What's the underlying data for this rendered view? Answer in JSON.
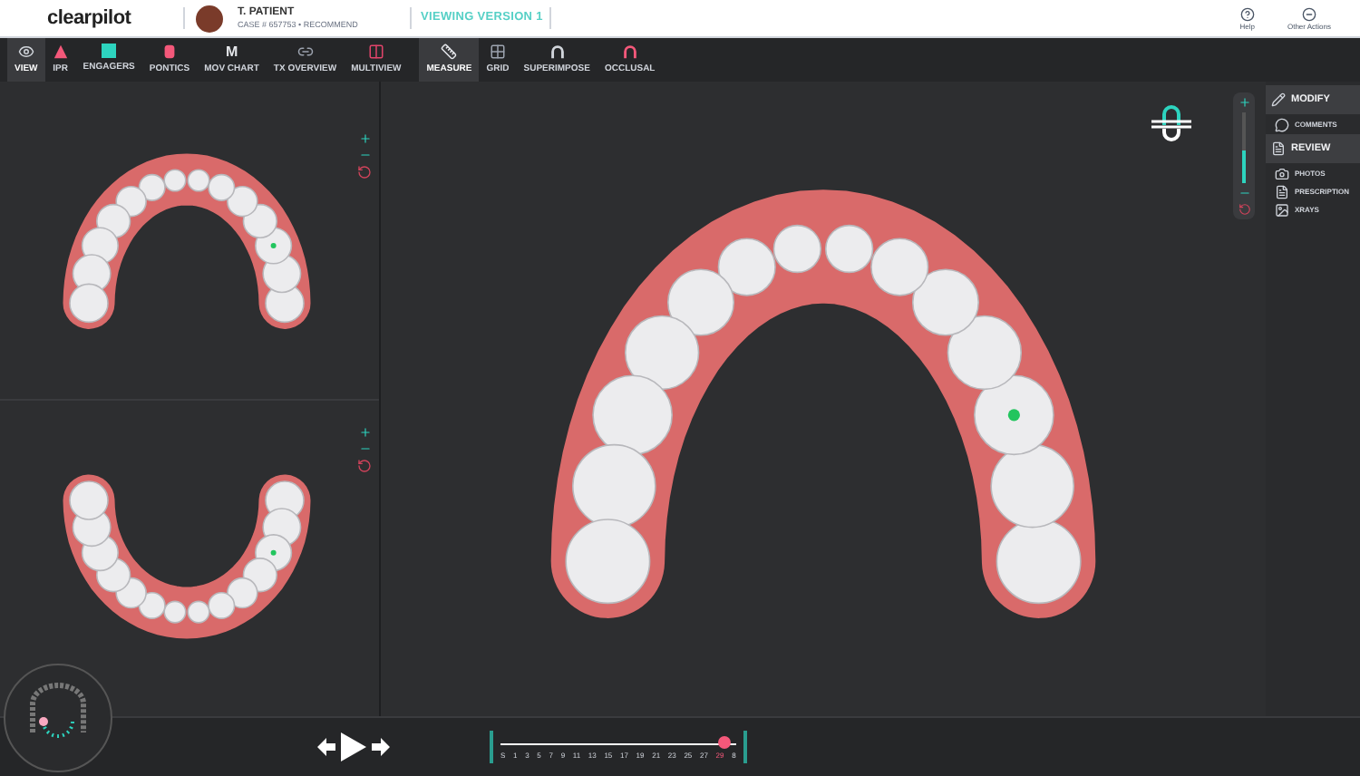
{
  "header": {
    "logo": "clearpilot",
    "patient_name": "T. PATIENT",
    "case_info": "CASE # 657753 • RECOMMEND",
    "version": "VIEWING VERSION 1",
    "actions": [
      {
        "label": "Help",
        "kind": "help"
      },
      {
        "label": "Other Actions",
        "kind": "more"
      }
    ]
  },
  "toolbar": [
    {
      "label": "VIEW",
      "kind": "eye",
      "selected": true
    },
    {
      "label": "IPR",
      "kind": "triangle",
      "selected": false
    },
    {
      "label": "ENGAGERS",
      "kind": "square",
      "selected": false
    },
    {
      "label": "PONTICS",
      "kind": "pontic",
      "selected": false
    },
    {
      "label": "MOV CHART",
      "kind": "letter",
      "icon_text": "M",
      "selected": false
    },
    {
      "label": "TX OVERVIEW",
      "kind": "link",
      "selected": false
    },
    {
      "label": "MULTIVIEW",
      "kind": "multiview",
      "selected": false
    },
    {
      "label": "MEASURE",
      "kind": "measure",
      "selected": true
    },
    {
      "label": "GRID",
      "kind": "grid",
      "selected": false
    },
    {
      "label": "SUPERIMPOSE",
      "kind": "arch",
      "selected": false
    },
    {
      "label": "OCCLUSAL",
      "kind": "arch-red",
      "selected": false
    }
  ],
  "zoom_slider": {
    "level": 0.45
  },
  "side_panel": [
    {
      "label": "MODIFY",
      "kind": "section"
    },
    {
      "label": "COMMENTS",
      "kind": "item"
    },
    {
      "label": "REVIEW",
      "kind": "section"
    },
    {
      "label": "PHOTOS",
      "kind": "item"
    },
    {
      "label": "PRESCRIPTION",
      "kind": "item"
    },
    {
      "label": "XRAYS",
      "kind": "item"
    }
  ],
  "timeline": {
    "level": 0.95,
    "labels": [
      {
        "text": "S",
        "selected": false
      },
      {
        "text": "1",
        "selected": false
      },
      {
        "text": "3",
        "selected": false
      },
      {
        "text": "5",
        "selected": false
      },
      {
        "text": "7",
        "selected": false
      },
      {
        "text": "9",
        "selected": false
      },
      {
        "text": "11",
        "selected": false
      },
      {
        "text": "13",
        "selected": false
      },
      {
        "text": "15",
        "selected": false
      },
      {
        "text": "17",
        "selected": false
      },
      {
        "text": "19",
        "selected": false
      },
      {
        "text": "21",
        "selected": false
      },
      {
        "text": "23",
        "selected": false
      },
      {
        "text": "25",
        "selected": false
      },
      {
        "text": "27",
        "selected": false
      },
      {
        "text": "29",
        "selected": true
      },
      {
        "text": "8",
        "selected": false
      }
    ]
  }
}
